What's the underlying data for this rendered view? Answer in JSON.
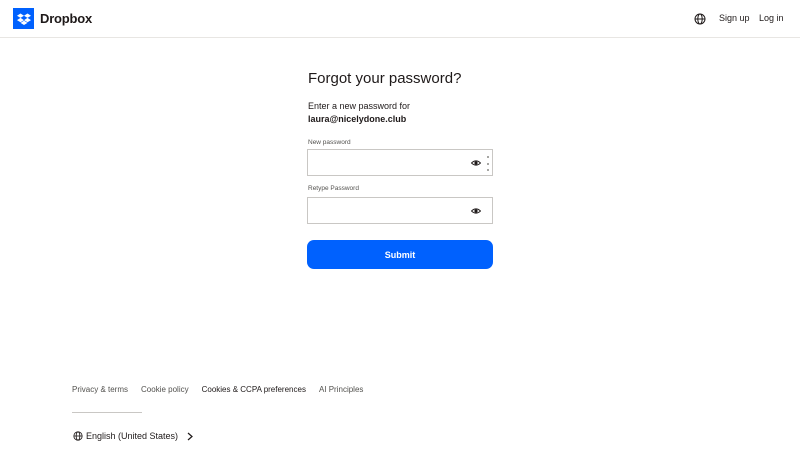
{
  "header": {
    "brand": "Dropbox",
    "logo_icon": "dropbox-logo-icon",
    "language_icon": "globe-icon",
    "signup_label": "Sign up",
    "login_label": "Log in"
  },
  "main": {
    "title": "Forgot your password?",
    "prompt": "Enter a new password for",
    "email": "laura@nicelydone.club",
    "new_password": {
      "label": "New password",
      "value": "",
      "toggle_icon": "eye-icon",
      "extra_icon": "kebab-menu-icon"
    },
    "retype_password": {
      "label": "Retype Password",
      "value": "",
      "toggle_icon": "eye-icon"
    },
    "submit_label": "Submit"
  },
  "footer": {
    "links": [
      "Privacy & terms",
      "Cookie policy",
      "Cookies & CCPA preferences",
      "AI Principles"
    ],
    "language": "English (United States)",
    "language_icon": "globe-icon",
    "language_chevron": "chevron-right-icon"
  },
  "colors": {
    "accent": "#0061fe",
    "text": "#1e1919",
    "muted": "#52514e",
    "border": "#c9c7c4"
  }
}
